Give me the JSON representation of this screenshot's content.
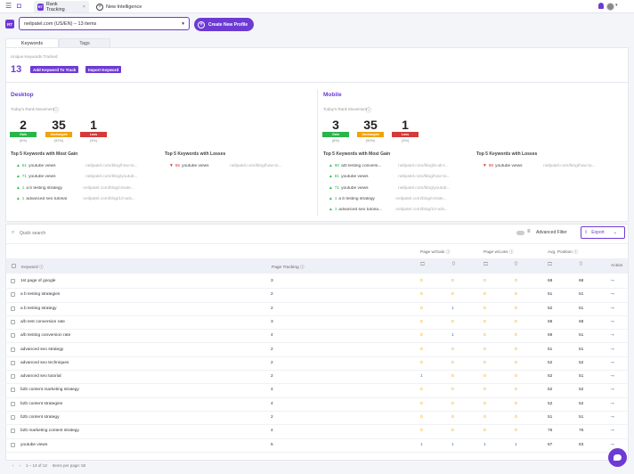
{
  "topbar": {
    "tabs": [
      {
        "badge": "RT",
        "label": "Rank Tracking",
        "close": "×"
      },
      {
        "label": "New Intelligence"
      }
    ]
  },
  "project": {
    "badge": "RT",
    "selected": "neilpatel.com (US/EN) – 13 items",
    "create_label": "Create New Profile"
  },
  "subtabs": [
    "Keywords",
    "Tags"
  ],
  "summary": {
    "unique_label": "Unique Keywords Tracked",
    "unique_count": "13",
    "add_label": "Add Keyword To Track",
    "import_label": "Import Keyword"
  },
  "desktop": {
    "title": "Desktop",
    "movement_label": "Today's Rank Movement",
    "gain": {
      "n": "2",
      "label": "Gain",
      "pct": "(5%)"
    },
    "unchanged": {
      "n": "35",
      "label": "Unchanged",
      "pct": "(92%)"
    },
    "loss": {
      "n": "1",
      "label": "Loss",
      "pct": "(3%)"
    },
    "gain_title": "Top 5 Keywords with Most Gain",
    "loss_title": "Top 5 Keywords with Losses",
    "gains": [
      {
        "delta": "51",
        "kw": "youtube views",
        "url": "neilpatel.com/blog/how-to..."
      },
      {
        "delta": "71",
        "kw": "youtube views",
        "url": "neilpatel.com/blog/youtub..."
      },
      {
        "delta": "1",
        "kw": "a b testing strategy",
        "url": "neilpatel.com/blog/create..."
      },
      {
        "delta": "1",
        "kw": "advanced seo tutorial",
        "url": "neilpatel.com/blog/10-adv..."
      }
    ],
    "losses": [
      {
        "delta": "66",
        "kw": "youtube views",
        "url": "neilpatel.com/blog/how-to..."
      }
    ]
  },
  "mobile": {
    "title": "Mobile",
    "movement_label": "Today's Rank Movement",
    "gain": {
      "n": "3",
      "label": "Gain",
      "pct": "(8%)"
    },
    "unchanged": {
      "n": "35",
      "label": "Unchanged",
      "pct": "(90%)"
    },
    "loss": {
      "n": "1",
      "label": "Loss",
      "pct": "(3%)"
    },
    "gain_title": "Top 5 Keywords with Most Gain",
    "loss_title": "Top 5 Keywords with Losses",
    "gains": [
      {
        "delta": "90",
        "kw": "a/b testing conversi...",
        "url": "neilpatel.com/blog/5-ab-t..."
      },
      {
        "delta": "81",
        "kw": "youtube views",
        "url": "neilpatel.com/blog/how-to..."
      },
      {
        "delta": "71",
        "kw": "youtube views",
        "url": "neilpatel.com/blog/youtub..."
      },
      {
        "delta": "1",
        "kw": "a b testing strategy",
        "url": "neilpatel.com/blog/create..."
      },
      {
        "delta": "1",
        "kw": "advanced seo tutoria...",
        "url": "neilpatel.com/blog/10-adv..."
      }
    ],
    "losses": [
      {
        "delta": "88",
        "kw": "youtube views",
        "url": "neilpatel.com/blog/how-to..."
      }
    ]
  },
  "table": {
    "search_placeholder": "Quick search",
    "advanced_filter": "Advanced Filter",
    "export": "Export",
    "group_gain": "Page w/Gain",
    "group_loss": "Page w/Loss",
    "group_pos": "Avg. Position",
    "col_keyword": "Keyword",
    "col_tracking": "Page Tracking",
    "col_action": "Action",
    "rows": [
      {
        "kw": "1st page of google",
        "pt": "3",
        "v": [
          "0",
          "0",
          "0",
          "0",
          "68",
          "68"
        ]
      },
      {
        "kw": "a b testing strategies",
        "pt": "2",
        "v": [
          "0",
          "0",
          "0",
          "0",
          "51",
          "51"
        ]
      },
      {
        "kw": "a b testing strategy",
        "pt": "2",
        "v": [
          "0",
          "1",
          "0",
          "0",
          "52",
          "51"
        ]
      },
      {
        "kw": "a/b test conversion rate",
        "pt": "3",
        "v": [
          "0",
          "0",
          "0",
          "0",
          "68",
          "68"
        ]
      },
      {
        "kw": "a/b testing conversion rate",
        "pt": "4",
        "v": [
          "0",
          "1",
          "0",
          "0",
          "69",
          "51"
        ]
      },
      {
        "kw": "advanced seo strategy",
        "pt": "2",
        "v": [
          "0",
          "0",
          "0",
          "0",
          "51",
          "51"
        ]
      },
      {
        "kw": "advanced seo techniques",
        "pt": "2",
        "v": [
          "0",
          "0",
          "0",
          "0",
          "52",
          "52"
        ]
      },
      {
        "kw": "advanced seo tutorial",
        "pt": "2",
        "v": [
          "1",
          "0",
          "0",
          "0",
          "52",
          "51"
        ]
      },
      {
        "kw": "b2b content marketing strategy",
        "pt": "4",
        "v": [
          "0",
          "0",
          "0",
          "0",
          "52",
          "52"
        ]
      },
      {
        "kw": "b2b content strategies",
        "pt": "4",
        "v": [
          "0",
          "0",
          "0",
          "0",
          "52",
          "52"
        ]
      },
      {
        "kw": "b2b content strategy",
        "pt": "2",
        "v": [
          "0",
          "0",
          "0",
          "0",
          "51",
          "51"
        ]
      },
      {
        "kw": "b2b marketing content strategy",
        "pt": "4",
        "v": [
          "0",
          "0",
          "0",
          "0",
          "76",
          "76"
        ]
      },
      {
        "kw": "youtube views",
        "pt": "5",
        "v": [
          "1",
          "1",
          "1",
          "1",
          "87",
          "83"
        ]
      }
    ],
    "footer_range": "1 – 13 of 13",
    "footer_pp": "Items per page: 50"
  }
}
